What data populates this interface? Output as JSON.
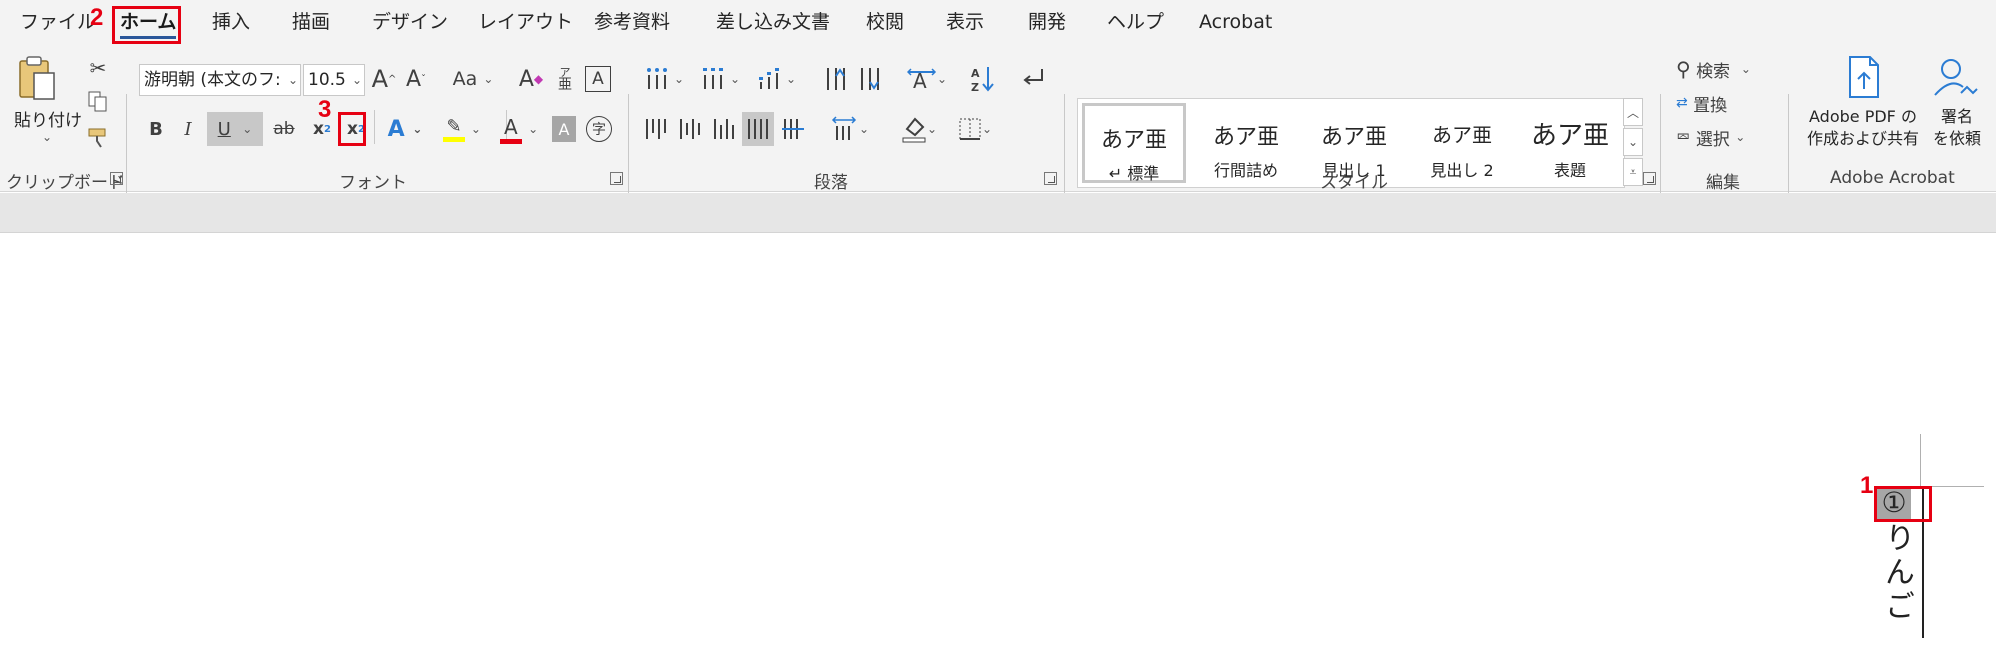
{
  "tabs": [
    {
      "label": "ファイル"
    },
    {
      "label": "ホーム"
    },
    {
      "label": "挿入"
    },
    {
      "label": "描画"
    },
    {
      "label": "デザイン"
    },
    {
      "label": "レイアウト"
    },
    {
      "label": "参考資料"
    },
    {
      "label": "差し込み文書"
    },
    {
      "label": "校閲"
    },
    {
      "label": "表示"
    },
    {
      "label": "開発"
    },
    {
      "label": "ヘルプ"
    },
    {
      "label": "Acrobat"
    }
  ],
  "active_tab": "ホーム",
  "accent_color": "#2b579a",
  "callout_color": "#e60012",
  "callouts": {
    "step1": "1",
    "step2": "2",
    "step3": "3"
  },
  "clipboard": {
    "paste_label": "貼り付け",
    "group_label": "クリップボード",
    "icons": [
      "paste-icon",
      "cut-icon",
      "copy-icon",
      "format-painter-icon"
    ]
  },
  "font": {
    "font_name": "游明朝 (本文のフ:",
    "font_size": "10.5",
    "grow_icon": "A",
    "shrink_icon": "A",
    "case_label": "Aa",
    "bold": "B",
    "italic": "I",
    "underline": "U",
    "strike": "ab",
    "subscript": "x",
    "subscript_small": "2",
    "superscript": "x",
    "superscript_small": "2",
    "ruby_top": "ア",
    "ruby_bottom": "亜",
    "border_char": "A",
    "effects_char": "A",
    "color_char": "A",
    "shade_char": "A",
    "enclose_char": "字",
    "highlight_color": "#ffff00",
    "font_color": "#e60012",
    "group_label": "フォント"
  },
  "paragraph": {
    "group_label": "段落"
  },
  "styles": {
    "items": [
      {
        "sample": "あア亜",
        "name": "↵ 標準"
      },
      {
        "sample": "あア亜",
        "name": "行間詰め"
      },
      {
        "sample": "あア亜",
        "name": "見出し 1"
      },
      {
        "sample": "あア亜",
        "name": "見出し 2"
      },
      {
        "sample": "あア亜",
        "name": "表題"
      }
    ],
    "group_label": "スタイル"
  },
  "editing": {
    "find_label": "検索",
    "replace_label": "置換",
    "select_label": "選択",
    "group_label": "編集"
  },
  "acrobat": {
    "create_share_line1": "Adobe PDF の",
    "create_share_line2": "作成および共有",
    "request_sign_line1": "署名",
    "request_sign_line2": "を依頼",
    "group_label": "Adobe Acrobat"
  },
  "document": {
    "circled_number": "①",
    "vertical_text": "りんご"
  }
}
